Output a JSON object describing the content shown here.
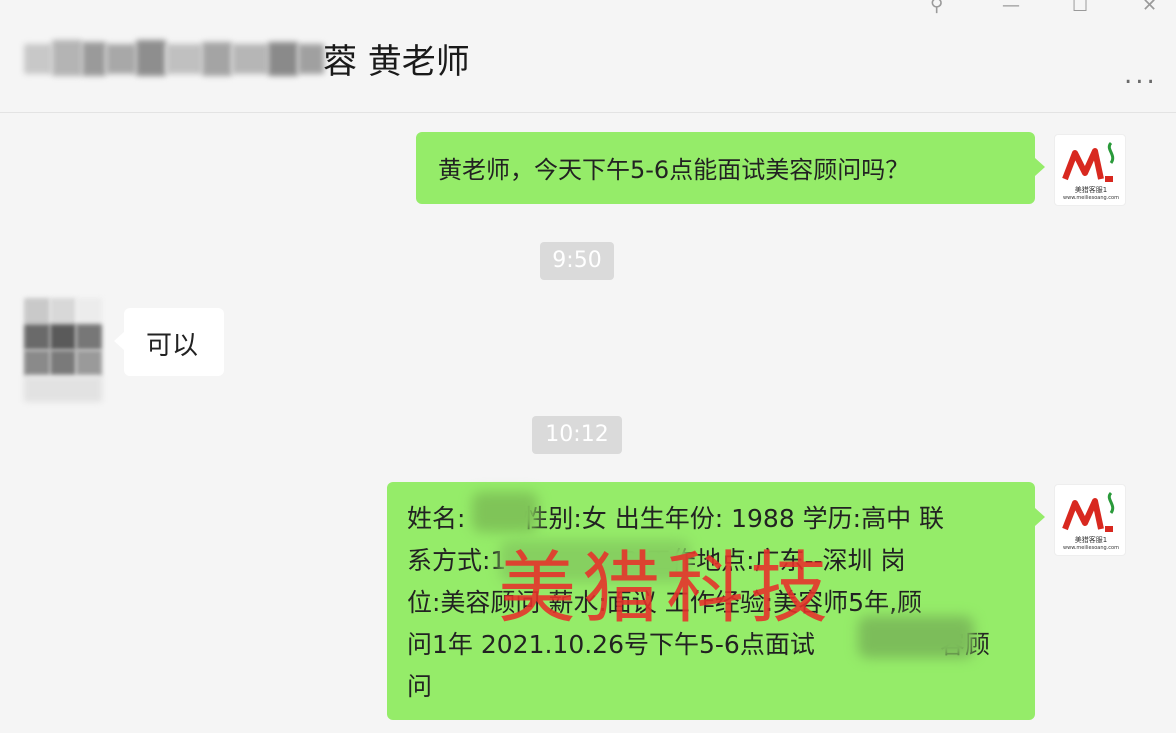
{
  "window": {
    "controls": {
      "pin_glyph": "⚲",
      "minimize_glyph": "—",
      "maximize_glyph": "☐",
      "close_glyph": "✕"
    },
    "title": "蓉 黄老师",
    "more_glyph": "..."
  },
  "messages": {
    "m1": {
      "text": "黄老师，今天下午5-6点能面试美容顾问吗？"
    },
    "t1": "9:50",
    "m2": {
      "text": "可以"
    },
    "t2": "10:12",
    "m3": {
      "lines": [
        "姓名:　　 性别:女 出生年份: 1988 学历:高中 联",
        "系方式:1 　　　　 3 工作地点:广东--深圳 岗",
        "位:美容顾问 薪水:面议 工作经验:美容师5年,顾",
        "问1年 2021.10.26号下午5-6点面试　　　　　容顾",
        "问"
      ]
    }
  },
  "avatar": {
    "logo_caption": "美猎客服1",
    "logo_sub": "www.meiliesoang.com"
  },
  "watermark": "美猎科技",
  "colors": {
    "bubble_green": "#95ec69",
    "watermark": "#e8302a",
    "timestamp_bg": "#dadada"
  }
}
